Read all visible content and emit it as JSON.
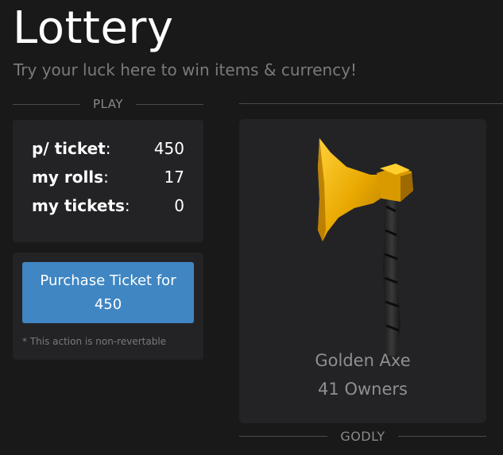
{
  "header": {
    "title": "Lottery",
    "subtitle": "Try your luck here to win items & currency!"
  },
  "play_section": {
    "divider_label": "PLAY"
  },
  "stats": [
    {
      "key": "p/ ticket",
      "value": "450"
    },
    {
      "key": "my rolls",
      "value": "17"
    },
    {
      "key": "my tickets",
      "value": "0"
    }
  ],
  "purchase": {
    "button_line1": "Purchase Ticket for",
    "button_line2": "450",
    "disclaimer": "* This action is non-revertable"
  },
  "item": {
    "name": "Golden Axe",
    "owners": "41 Owners",
    "rarity": "GODLY",
    "icon": "golden-axe-icon"
  },
  "colors": {
    "background": "#191919",
    "panel": "#232326",
    "accent_button": "#3f86c3",
    "muted_text": "#8f8f8f",
    "axe_gold": "#f0b400"
  }
}
